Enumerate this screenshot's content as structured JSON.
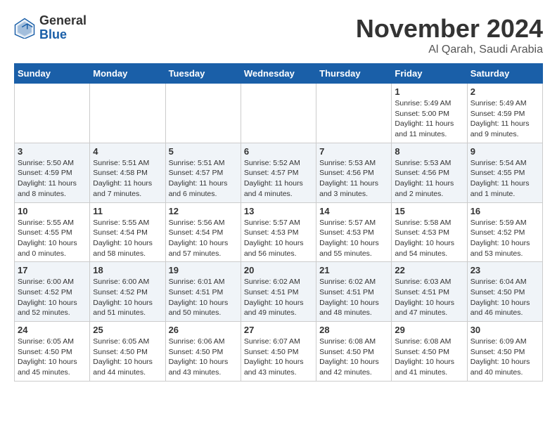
{
  "header": {
    "logo_general": "General",
    "logo_blue": "Blue",
    "month_title": "November 2024",
    "location": "Al Qarah, Saudi Arabia"
  },
  "weekdays": [
    "Sunday",
    "Monday",
    "Tuesday",
    "Wednesday",
    "Thursday",
    "Friday",
    "Saturday"
  ],
  "weeks": [
    [
      null,
      null,
      null,
      null,
      null,
      {
        "day": 1,
        "sunrise": "5:49 AM",
        "sunset": "5:00 PM",
        "daylight": "11 hours and 11 minutes."
      },
      {
        "day": 2,
        "sunrise": "5:49 AM",
        "sunset": "4:59 PM",
        "daylight": "11 hours and 9 minutes."
      }
    ],
    [
      {
        "day": 3,
        "sunrise": "5:50 AM",
        "sunset": "4:59 PM",
        "daylight": "11 hours and 8 minutes."
      },
      {
        "day": 4,
        "sunrise": "5:51 AM",
        "sunset": "4:58 PM",
        "daylight": "11 hours and 7 minutes."
      },
      {
        "day": 5,
        "sunrise": "5:51 AM",
        "sunset": "4:57 PM",
        "daylight": "11 hours and 6 minutes."
      },
      {
        "day": 6,
        "sunrise": "5:52 AM",
        "sunset": "4:57 PM",
        "daylight": "11 hours and 4 minutes."
      },
      {
        "day": 7,
        "sunrise": "5:53 AM",
        "sunset": "4:56 PM",
        "daylight": "11 hours and 3 minutes."
      },
      {
        "day": 8,
        "sunrise": "5:53 AM",
        "sunset": "4:56 PM",
        "daylight": "11 hours and 2 minutes."
      },
      {
        "day": 9,
        "sunrise": "5:54 AM",
        "sunset": "4:55 PM",
        "daylight": "11 hours and 1 minute."
      }
    ],
    [
      {
        "day": 10,
        "sunrise": "5:55 AM",
        "sunset": "4:55 PM",
        "daylight": "10 hours and 0 minutes."
      },
      {
        "day": 11,
        "sunrise": "5:55 AM",
        "sunset": "4:54 PM",
        "daylight": "10 hours and 58 minutes."
      },
      {
        "day": 12,
        "sunrise": "5:56 AM",
        "sunset": "4:54 PM",
        "daylight": "10 hours and 57 minutes."
      },
      {
        "day": 13,
        "sunrise": "5:57 AM",
        "sunset": "4:53 PM",
        "daylight": "10 hours and 56 minutes."
      },
      {
        "day": 14,
        "sunrise": "5:57 AM",
        "sunset": "4:53 PM",
        "daylight": "10 hours and 55 minutes."
      },
      {
        "day": 15,
        "sunrise": "5:58 AM",
        "sunset": "4:53 PM",
        "daylight": "10 hours and 54 minutes."
      },
      {
        "day": 16,
        "sunrise": "5:59 AM",
        "sunset": "4:52 PM",
        "daylight": "10 hours and 53 minutes."
      }
    ],
    [
      {
        "day": 17,
        "sunrise": "6:00 AM",
        "sunset": "4:52 PM",
        "daylight": "10 hours and 52 minutes."
      },
      {
        "day": 18,
        "sunrise": "6:00 AM",
        "sunset": "4:52 PM",
        "daylight": "10 hours and 51 minutes."
      },
      {
        "day": 19,
        "sunrise": "6:01 AM",
        "sunset": "4:51 PM",
        "daylight": "10 hours and 50 minutes."
      },
      {
        "day": 20,
        "sunrise": "6:02 AM",
        "sunset": "4:51 PM",
        "daylight": "10 hours and 49 minutes."
      },
      {
        "day": 21,
        "sunrise": "6:02 AM",
        "sunset": "4:51 PM",
        "daylight": "10 hours and 48 minutes."
      },
      {
        "day": 22,
        "sunrise": "6:03 AM",
        "sunset": "4:51 PM",
        "daylight": "10 hours and 47 minutes."
      },
      {
        "day": 23,
        "sunrise": "6:04 AM",
        "sunset": "4:50 PM",
        "daylight": "10 hours and 46 minutes."
      }
    ],
    [
      {
        "day": 24,
        "sunrise": "6:05 AM",
        "sunset": "4:50 PM",
        "daylight": "10 hours and 45 minutes."
      },
      {
        "day": 25,
        "sunrise": "6:05 AM",
        "sunset": "4:50 PM",
        "daylight": "10 hours and 44 minutes."
      },
      {
        "day": 26,
        "sunrise": "6:06 AM",
        "sunset": "4:50 PM",
        "daylight": "10 hours and 43 minutes."
      },
      {
        "day": 27,
        "sunrise": "6:07 AM",
        "sunset": "4:50 PM",
        "daylight": "10 hours and 43 minutes."
      },
      {
        "day": 28,
        "sunrise": "6:08 AM",
        "sunset": "4:50 PM",
        "daylight": "10 hours and 42 minutes."
      },
      {
        "day": 29,
        "sunrise": "6:08 AM",
        "sunset": "4:50 PM",
        "daylight": "10 hours and 41 minutes."
      },
      {
        "day": 30,
        "sunrise": "6:09 AM",
        "sunset": "4:50 PM",
        "daylight": "10 hours and 40 minutes."
      }
    ]
  ]
}
